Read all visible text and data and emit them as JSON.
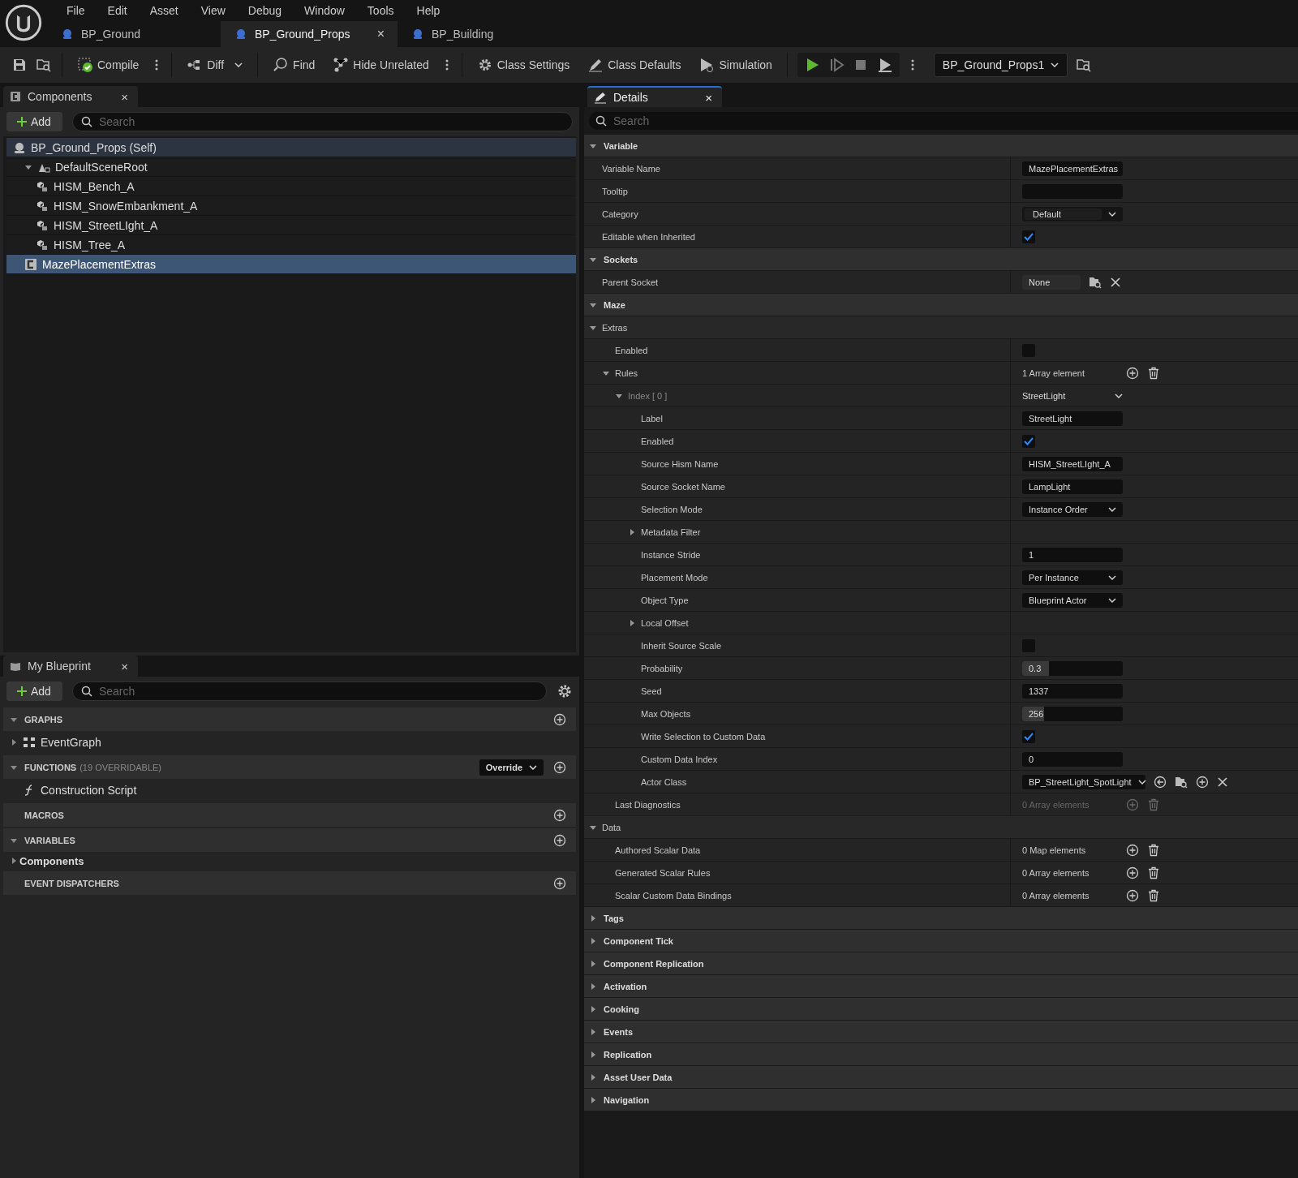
{
  "menu": [
    "File",
    "Edit",
    "Asset",
    "View",
    "Debug",
    "Window",
    "Tools",
    "Help"
  ],
  "tabs": [
    {
      "label": "BP_Ground",
      "selected": false
    },
    {
      "label": "BP_Ground_Props",
      "selected": true,
      "close": "×"
    },
    {
      "label": "BP_Building",
      "selected": false
    }
  ],
  "toolbar": {
    "compile": "Compile",
    "diff": "Diff",
    "find": "Find",
    "hide_unrelated": "Hide Unrelated",
    "class_settings": "Class Settings",
    "class_defaults": "Class Defaults",
    "simulation": "Simulation",
    "debug_object": "BP_Ground_Props1"
  },
  "components_panel": {
    "title": "Components",
    "selected": false,
    "close": "×",
    "add": "Add",
    "search": {
      "placeholder": "Search"
    },
    "tree": [
      {
        "label": "BP_Ground_Props (Self)",
        "kind": "self",
        "selected": false,
        "children": [
          {
            "label": "DefaultSceneRoot",
            "kind": "scene",
            "selected": false,
            "expanded": true,
            "children": [
              {
                "label": "HISM_Bench_A",
                "kind": "hism",
                "selected": false
              },
              {
                "label": "HISM_SnowEmbankment_A",
                "kind": "hism",
                "selected": false
              },
              {
                "label": "HISM_StreetLIght_A",
                "kind": "hism",
                "selected": false
              },
              {
                "label": "HISM_Tree_A",
                "kind": "hism",
                "selected": false
              }
            ]
          },
          {
            "label": "MazePlacementExtras",
            "kind": "component",
            "selected": true
          }
        ]
      }
    ]
  },
  "my_blueprint": {
    "title": "My Blueprint",
    "selected": false,
    "close": "×",
    "add": "Add",
    "search": {
      "placeholder": "Search"
    },
    "sections": [
      {
        "title": "GRAPHS",
        "expanded": true,
        "items": [
          {
            "label": "EventGraph",
            "kind": "graph",
            "expanded": false
          }
        ]
      },
      {
        "title": "FUNCTIONS",
        "note": "(19 OVERRIDABLE)",
        "override": "Override",
        "expanded": true,
        "items": [
          {
            "label": "Construction Script",
            "kind": "function"
          }
        ]
      },
      {
        "title": "MACROS"
      },
      {
        "title": "VARIABLES",
        "expanded": true,
        "items": [
          {
            "label": "Components",
            "kind": "category",
            "expanded": false
          }
        ]
      },
      {
        "title": "EVENT DISPATCHERS"
      }
    ]
  },
  "details": {
    "title": "Details",
    "selected": true,
    "close": "×",
    "search": {
      "placeholder": "Search"
    },
    "categories": [
      {
        "title": "Variable",
        "expanded": true,
        "rows": [
          {
            "label": "Variable Name",
            "kind": "text",
            "value": "MazePlacementExtras"
          },
          {
            "label": "Tooltip",
            "kind": "text"
          },
          {
            "label": "Category",
            "kind": "combo",
            "value": "Default"
          },
          {
            "label": "Editable when Inherited",
            "kind": "check",
            "checked": true
          }
        ]
      },
      {
        "title": "Sockets",
        "expanded": true,
        "rows": [
          {
            "label": "Parent Socket",
            "kind": "socket",
            "value": "None"
          }
        ]
      },
      {
        "title": "Maze",
        "expanded": true,
        "rows": [
          {
            "label": "Extras",
            "kind": "group",
            "expanded": true,
            "children": [
              {
                "label": "Enabled",
                "kind": "check",
                "checked": false
              },
              {
                "label": "Rules",
                "kind": "array",
                "value": "1 Array element",
                "disabled": false,
                "expanded": true,
                "children": [
                  {
                    "label": "Index [ 0 ]",
                    "kind": "element",
                    "value": "StreetLight",
                    "expanded": true,
                    "children": [
                      {
                        "label": "Label",
                        "kind": "text",
                        "value": "StreetLight"
                      },
                      {
                        "label": "Enabled",
                        "kind": "check",
                        "checked": true
                      },
                      {
                        "label": "Source Hism Name",
                        "kind": "text",
                        "value": "HISM_StreetLIght_A"
                      },
                      {
                        "label": "Source Socket Name",
                        "kind": "text",
                        "value": "LampLight"
                      },
                      {
                        "label": "Selection Mode",
                        "kind": "dropdown",
                        "value": "Instance Order"
                      },
                      {
                        "label": "Metadata Filter",
                        "kind": "struct",
                        "expanded": false
                      },
                      {
                        "label": "Instance Stride",
                        "kind": "text",
                        "value": "1"
                      },
                      {
                        "label": "Placement Mode",
                        "kind": "dropdown",
                        "value": "Per Instance"
                      },
                      {
                        "label": "Object Type",
                        "kind": "dropdown",
                        "value": "Blueprint Actor"
                      },
                      {
                        "label": "Local Offset",
                        "kind": "struct",
                        "expanded": false
                      },
                      {
                        "label": "Inherit Source Scale",
                        "kind": "check",
                        "checked": false
                      },
                      {
                        "label": "Probability",
                        "kind": "slider",
                        "value": "0.3",
                        "level": 0.27
                      },
                      {
                        "label": "Seed",
                        "kind": "text",
                        "value": "1337"
                      },
                      {
                        "label": "Max Objects",
                        "kind": "slider",
                        "value": "256",
                        "level": 0.22
                      },
                      {
                        "label": "Write Selection to Custom Data",
                        "kind": "check",
                        "checked": true
                      },
                      {
                        "label": "Custom Data Index",
                        "kind": "text",
                        "value": "0"
                      },
                      {
                        "label": "Actor Class",
                        "kind": "asset",
                        "value": "BP_StreetLight_SpotLight"
                      }
                    ]
                  }
                ]
              },
              {
                "label": "Last Diagnostics",
                "kind": "array",
                "value": "0 Array elements",
                "disabled": true
              }
            ]
          },
          {
            "label": "Data",
            "kind": "group",
            "expanded": true,
            "children": [
              {
                "label": "Authored Scalar Data",
                "kind": "array",
                "value": "0 Map elements",
                "disabled": false
              },
              {
                "label": "Generated Scalar Rules",
                "kind": "array",
                "value": "0 Array elements",
                "disabled": false
              },
              {
                "label": "Scalar Custom Data Bindings",
                "kind": "array",
                "value": "0 Array elements",
                "disabled": false
              }
            ]
          }
        ]
      },
      {
        "title": "Tags",
        "expanded": false
      },
      {
        "title": "Component Tick",
        "expanded": false
      },
      {
        "title": "Component Replication",
        "expanded": false
      },
      {
        "title": "Activation",
        "expanded": false
      },
      {
        "title": "Cooking",
        "expanded": false
      },
      {
        "title": "Events",
        "expanded": false
      },
      {
        "title": "Replication",
        "expanded": false
      },
      {
        "title": "Asset User Data",
        "expanded": false
      },
      {
        "title": "Navigation",
        "expanded": false
      }
    ]
  }
}
